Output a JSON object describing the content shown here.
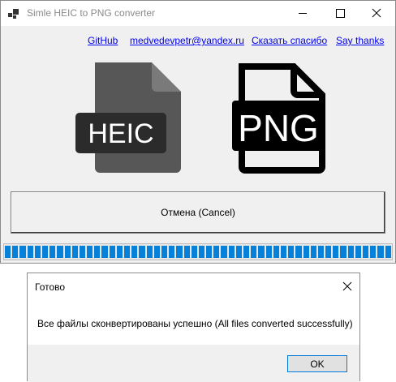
{
  "window": {
    "title": "Simle HEIC to PNG converter"
  },
  "links": [
    {
      "label": "GitHub"
    },
    {
      "label": "medvedevpetr@yandex.ru"
    },
    {
      "label": "Сказать спасибо"
    },
    {
      "label": "Say thanks"
    }
  ],
  "graphics": {
    "heic_label": "HEIC",
    "png_label": "PNG"
  },
  "cancel_button": {
    "label": "Отмена (Cancel)"
  },
  "progress": {
    "value": 1.0
  },
  "dialog": {
    "title": "Готово",
    "message": "Все файлы сконвертированы успешно (All files converted successfully)",
    "ok_label": "OK"
  },
  "colors": {
    "link": "#0000ee",
    "progress": "#0681d9",
    "accent": "#0078d7"
  }
}
